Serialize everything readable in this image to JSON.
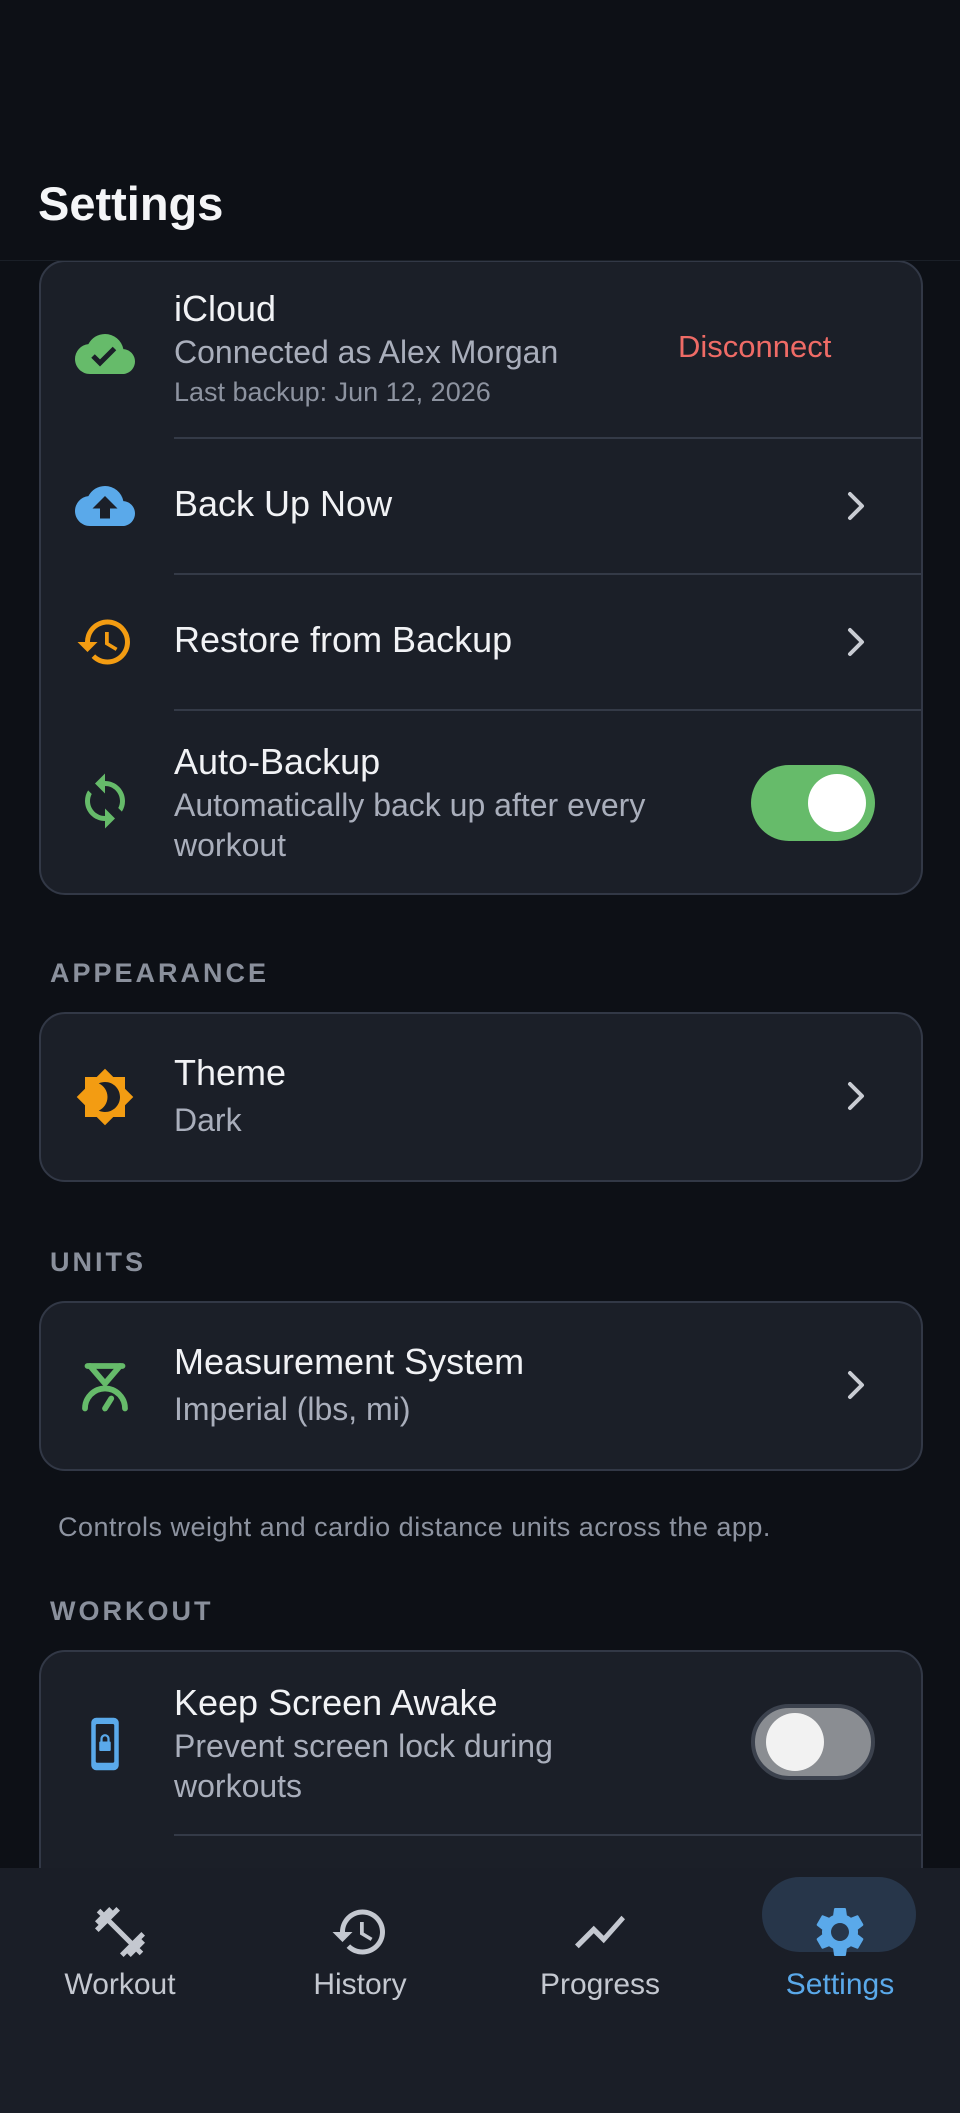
{
  "header": {
    "title": "Settings"
  },
  "icloud": {
    "title": "iCloud",
    "account": "Connected as Alex Morgan",
    "last_backup": "Last backup: Jun 12, 2026",
    "disconnect_label": "Disconnect",
    "backup_now": "Back Up Now",
    "restore": "Restore from Backup",
    "auto_backup_title": "Auto-Backup",
    "auto_backup_desc_1": "Automatically back up after every",
    "auto_backup_desc_2": "workout",
    "auto_backup_on": true
  },
  "appearance": {
    "section": "APPEARANCE",
    "theme_title": "Theme",
    "theme_value": "Dark"
  },
  "units": {
    "section": "UNITS",
    "measure_title": "Measurement System",
    "measure_value": "Imperial (lbs, mi)",
    "footnote": "Controls weight and cardio distance units across the app."
  },
  "workout": {
    "section": "WORKOUT",
    "keep_awake_title": "Keep Screen Awake",
    "keep_awake_desc_1": "Prevent screen lock during",
    "keep_awake_desc_2": "workouts",
    "keep_awake_on": false
  },
  "nav": {
    "items": [
      {
        "label": "Workout",
        "icon": "dumbbell-icon"
      },
      {
        "label": "History",
        "icon": "history-icon"
      },
      {
        "label": "Progress",
        "icon": "trend-icon"
      },
      {
        "label": "Settings",
        "icon": "gear-icon"
      }
    ],
    "active": "Settings"
  },
  "colors": {
    "background": "#0d1016",
    "card": "#1b1f28",
    "accent_blue": "#5aa9ea",
    "green": "#66bb6a",
    "orange": "#f39c12",
    "danger": "#ef6b66"
  }
}
